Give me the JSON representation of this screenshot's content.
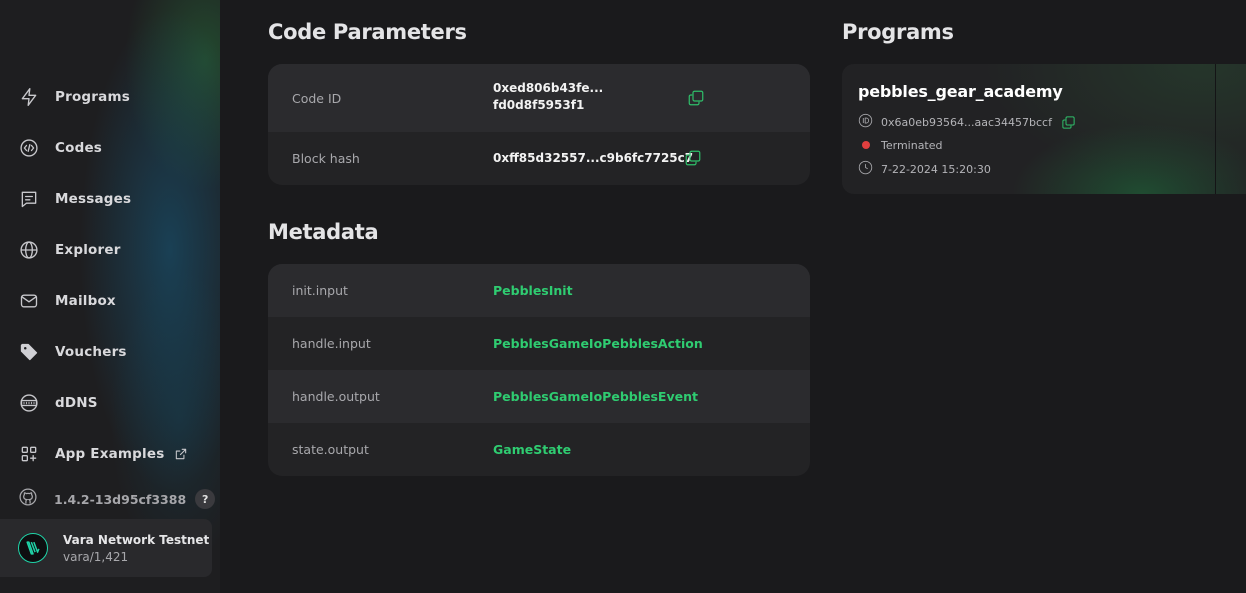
{
  "sidebar": {
    "nav": [
      {
        "label": "Programs",
        "icon": "lightning-icon"
      },
      {
        "label": "Codes",
        "icon": "code-icon"
      },
      {
        "label": "Messages",
        "icon": "message-icon"
      },
      {
        "label": "Explorer",
        "icon": "globe-icon"
      },
      {
        "label": "Mailbox",
        "icon": "mail-icon"
      },
      {
        "label": "Vouchers",
        "icon": "tag-icon"
      },
      {
        "label": "dDNS",
        "icon": "ddns-icon"
      },
      {
        "label": "App Examples",
        "icon": "apps-icon"
      }
    ],
    "version": "1.4.2-13d95cf3388",
    "help_label": "?",
    "network": {
      "name": "Vara Network Testnet",
      "sub": "vara/1,421"
    }
  },
  "code_parameters": {
    "title": "Code Parameters",
    "rows": [
      {
        "key": "Code ID",
        "value_line1": "0xed806b43fe...",
        "value_line2": "fd0d8f5953f1"
      },
      {
        "key": "Block hash",
        "value": "0xff85d32557...c9b6fc7725c7"
      }
    ]
  },
  "metadata": {
    "title": "Metadata",
    "rows": [
      {
        "key": "init.input",
        "value": "PebblesInit"
      },
      {
        "key": "handle.input",
        "value": "PebblesGameIoPebblesAction"
      },
      {
        "key": "handle.output",
        "value": "PebblesGameIoPebblesEvent"
      },
      {
        "key": "state.output",
        "value": "GameState"
      }
    ]
  },
  "programs": {
    "title": "Programs",
    "items": [
      {
        "name": "pebbles_gear_academy",
        "id": "0x6a0eb93564...aac34457bccf",
        "status": "Terminated",
        "timestamp": "7-22-2024 15:20:30"
      }
    ]
  },
  "colors": {
    "accent_green": "#2fcc71",
    "status_terminated": "#e03f3f",
    "background": "#1a1a1c",
    "panel": "#232325"
  }
}
